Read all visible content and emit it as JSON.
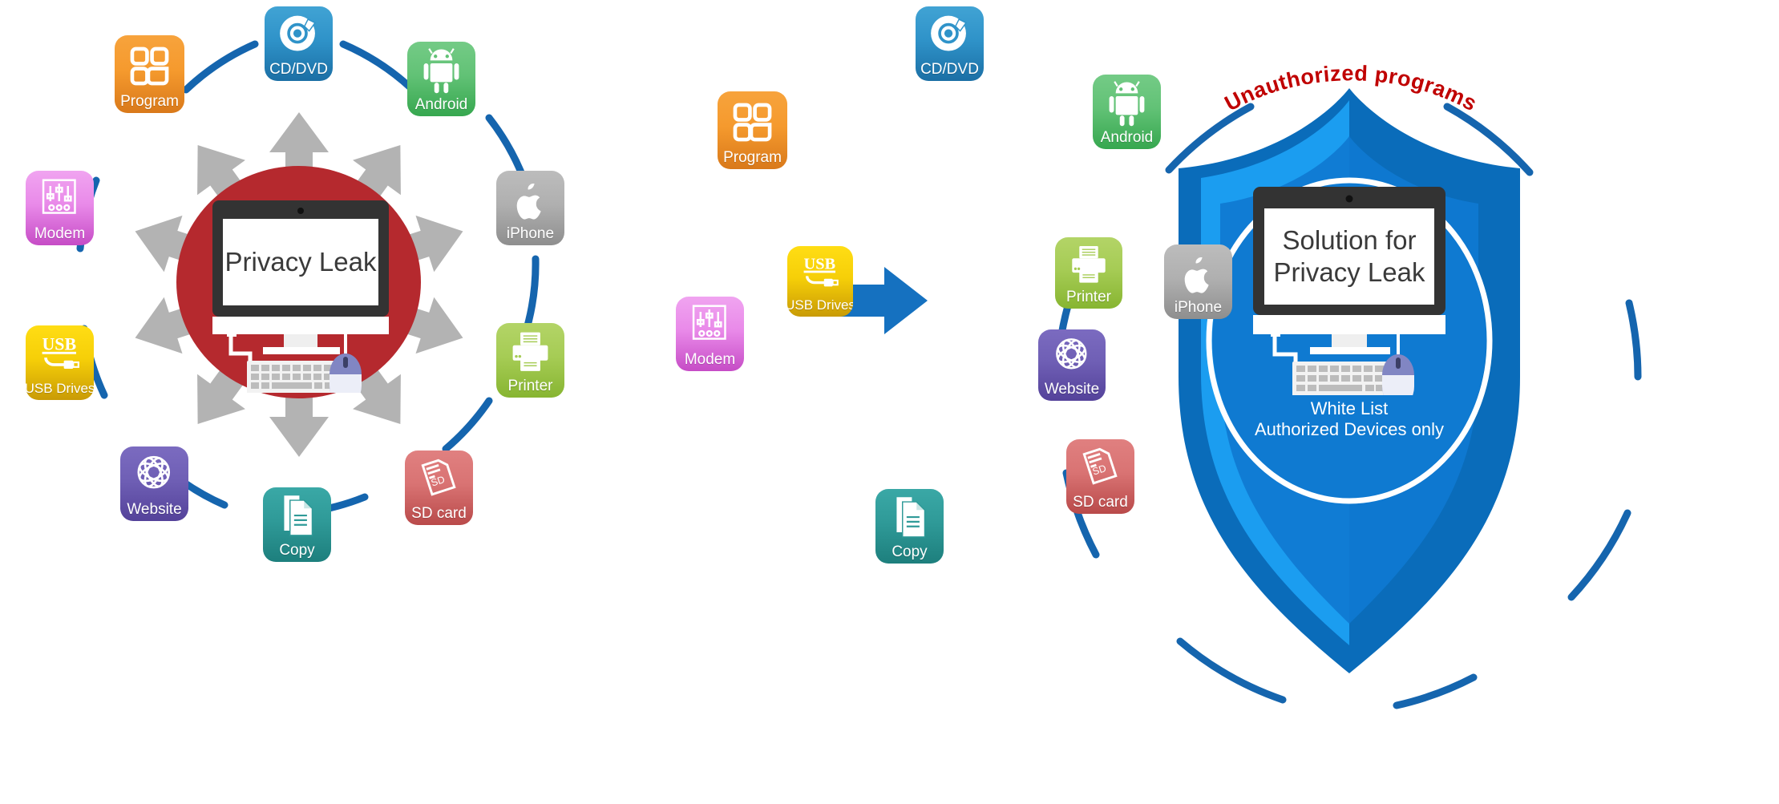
{
  "diagram": {
    "title_left": "Privacy Leak",
    "title_right": "Solution for\nPrivacy Leak",
    "title_right_line1": "Solution for",
    "title_right_line2": "Privacy Leak",
    "annotation_unauthorized": "Unauthorized programs",
    "whitelist_line1": "White List",
    "whitelist_line2": "Authorized Devices only",
    "transition_arrow": "right-arrow"
  },
  "colors": {
    "leak_circle": "#b5292e",
    "shield_outer": "#0a6cba",
    "shield_mid": "#1b9df0",
    "shield_inner": "#0f7ad1",
    "arc_blue": "#1565ae",
    "leak_arrow_gray": "#b3b3b3",
    "unauthorized_red": "#c00000",
    "transition_arrow_blue": "#1571c0",
    "screen_text": "#3a3a3a"
  },
  "left_panel": {
    "name": "privacy-leak-diagram",
    "center_label": "Privacy Leak",
    "nodes": [
      {
        "id": "cddvd",
        "label": "CD/DVD",
        "icon": "cd-dvd-icon",
        "color": "#2f93c9",
        "angle_deg": 90
      },
      {
        "id": "android",
        "label": "Android",
        "icon": "android-icon",
        "color": "#62c276",
        "angle_deg": 54
      },
      {
        "id": "iphone",
        "label": "iPhone",
        "icon": "apple-icon",
        "color": "#b0b0b0",
        "angle_deg": 18
      },
      {
        "id": "printer",
        "label": "Printer",
        "icon": "printer-icon",
        "color": "#a6cc55",
        "angle_deg": -18
      },
      {
        "id": "sdcard",
        "label": "SD card",
        "icon": "sd-card-icon",
        "color": "#d97373",
        "angle_deg": -54
      },
      {
        "id": "copy",
        "label": "Copy",
        "icon": "copy-icon",
        "color": "#2f9a98",
        "angle_deg": -90
      },
      {
        "id": "website",
        "label": "Website",
        "icon": "globe-icon",
        "color": "#6f5fb5",
        "angle_deg": -126
      },
      {
        "id": "usb",
        "label": "USB Drives",
        "icon": "usb-icon",
        "color": "#f6cf08",
        "angle_deg": -162
      },
      {
        "id": "modem",
        "label": "Modem",
        "icon": "modem-icon",
        "color": "#e98ae9",
        "angle_deg": 162
      },
      {
        "id": "program",
        "label": "Program",
        "icon": "program-icon",
        "color": "#f59a2e",
        "angle_deg": 126
      }
    ]
  },
  "right_panel": {
    "name": "solution-shield-diagram",
    "center_label_line1": "Solution for",
    "center_label_line2": "Privacy Leak",
    "shield_caption_line1": "White List",
    "shield_caption_line2": "Authorized Devices only",
    "banner": "Unauthorized programs",
    "outer_nodes": [
      {
        "id": "cddvd",
        "label": "CD/DVD",
        "icon": "cd-dvd-icon",
        "color": "#2f93c9"
      },
      {
        "id": "android",
        "label": "Android",
        "icon": "android-icon",
        "color": "#62c276"
      },
      {
        "id": "iphone",
        "label": "iPhone",
        "icon": "apple-icon",
        "color": "#b0b0b0"
      },
      {
        "id": "sdcard",
        "label": "SD card",
        "icon": "sd-card-icon",
        "color": "#d97373"
      },
      {
        "id": "copy",
        "label": "Copy",
        "icon": "copy-icon",
        "color": "#2f9a98"
      },
      {
        "id": "modem",
        "label": "Modem",
        "icon": "modem-icon",
        "color": "#e98ae9"
      },
      {
        "id": "program",
        "label": "Program",
        "icon": "program-icon",
        "color": "#f59a2e"
      }
    ],
    "inner_nodes": [
      {
        "id": "usb",
        "label": "USB Drives",
        "icon": "usb-icon",
        "color": "#f6cf08"
      },
      {
        "id": "printer",
        "label": "Printer",
        "icon": "printer-icon",
        "color": "#a6cc55"
      },
      {
        "id": "website",
        "label": "Website",
        "icon": "globe-icon",
        "color": "#6f5fb5"
      }
    ]
  }
}
